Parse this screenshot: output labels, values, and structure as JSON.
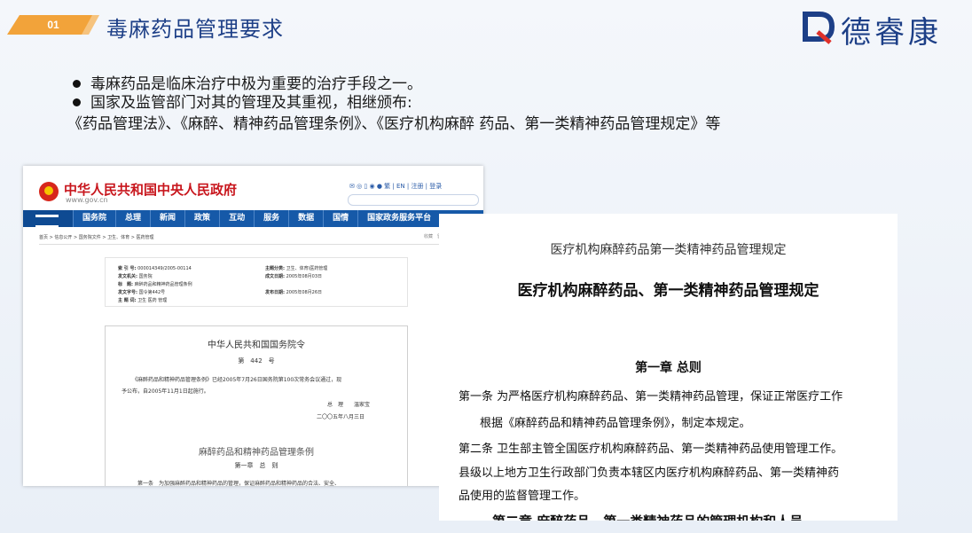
{
  "header": {
    "number": "01",
    "title": "毒麻药品管理要求",
    "logo_text": "德睿康",
    "accent_color": "#f2a33a",
    "title_color": "#1d3f87"
  },
  "bullets": {
    "line1": "毒麻药品是临床治疗中极为重要的治疗手段之一。",
    "line2": "国家及监管部门对其的管理及其重视，相继颁布:",
    "line3": "《药品管理法》、《麻醉、精神药品管理条例》、《医疗机构麻醉 药品、第一类精神药品管理规定》等"
  },
  "gov_site": {
    "name": "中华人民共和国中央人民政府",
    "url": "www.gov.cn",
    "top_links": "繁 | EN | 注册 | 登录",
    "nav": [
      "国务院",
      "总理",
      "新闻",
      "政策",
      "互动",
      "服务",
      "数据",
      "国情",
      "国家政务服务平台"
    ],
    "breadcrumb": "首页 > 信息公开 > 国务院文件 > 卫生、体育 > 医药管理",
    "tools": [
      "收藏",
      "留言"
    ],
    "meta": [
      {
        "k": "索 引 号:",
        "v": "000014349/2005-00114"
      },
      {
        "k": "主题分类:",
        "v": "卫生、体育\\医药管理"
      },
      {
        "k": "发文机关:",
        "v": "国务院"
      },
      {
        "k": "成文日期:",
        "v": "2005年08月03日"
      },
      {
        "k": "标　题:",
        "v": "麻醉药品和精神药品管理条例"
      },
      {
        "k": "发文字号:",
        "v": "国令第442号"
      },
      {
        "k": "发布日期:",
        "v": "2005年08月26日"
      },
      {
        "k": "主 题 词:",
        "v": "卫生 医药 管理"
      }
    ],
    "order_title": "中华人民共和国国务院令",
    "order_no": "第　442　号",
    "order_p1": "《麻醉药品和精神药品管理条例》已经2005年7月26日国务院第100次常务会议通过，现",
    "order_p2": "予公布，自2005年11月1日起施行。",
    "signer": "总　理　　温家宝",
    "sign_date": "二〇〇五年八月三日",
    "reg_title": "麻醉药品和精神药品管理条例",
    "reg_chapter": "第一章　总　则",
    "reg_art1": "第一条　为加强麻醉药品和精神药品的管理，保证麻醉药品和精神药品的合法、安全、"
  },
  "regulation_doc": {
    "header_line": "医疗机构麻醉药品第一类精神药品管理规定",
    "title": "医疗机构麻醉药品、第一类精神药品管理规定",
    "chapter": "第一章 总则",
    "p1": "第一条 为严格医疗机构麻醉药品、第一类精神药品管理，保证正常医疗工作",
    "p2": "根据《麻醉药品和精神药品管理条例》，制定本规定。",
    "p3": "第二条 卫生部主管全国医疗机构麻醉药品、第一类精神药品使用管理工作。",
    "p4": "县级以上地方卫生行政部门负责本辖区内医疗机构麻醉药品、第一类精神药",
    "p5": "品使用的监督管理工作。",
    "p6": "第二章 麻醉药品、第一类精神药品的管理机构和人员"
  }
}
